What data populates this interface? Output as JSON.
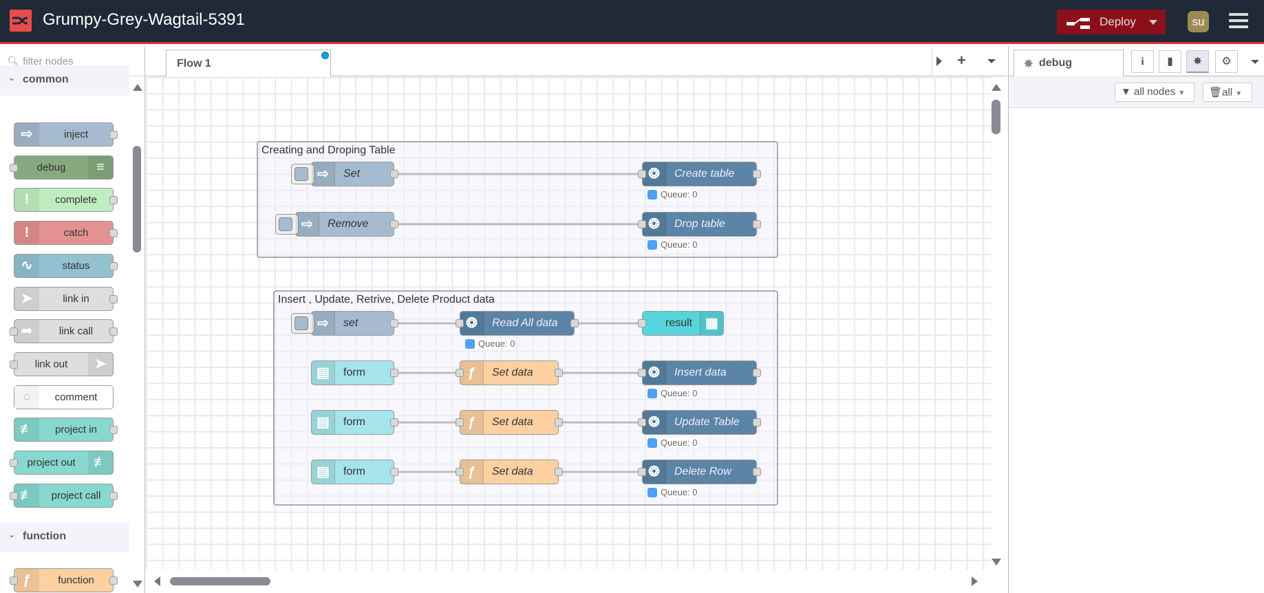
{
  "header": {
    "title": "Grumpy-Grey-Wagtail-5391",
    "deploy_label": "Deploy",
    "avatar_initials": "su",
    "accent": "#8c101c"
  },
  "palette": {
    "filter_placeholder": "filter nodes",
    "categories": [
      {
        "label": "common",
        "nodes": [
          {
            "label": "inject",
            "color": "#a6bbcf",
            "icon": "arrow-right-icon",
            "icon_side": "left",
            "in": false,
            "out": true
          },
          {
            "label": "debug",
            "color": "#87a980",
            "icon": "list-icon",
            "icon_side": "right",
            "in": true,
            "out": false
          },
          {
            "label": "complete",
            "color": "#c0edc0",
            "icon": "exclamation-icon",
            "icon_side": "left",
            "in": false,
            "out": true
          },
          {
            "label": "catch",
            "color": "#e49191",
            "icon": "exclamation-icon",
            "icon_side": "left",
            "in": false,
            "out": true
          },
          {
            "label": "status",
            "color": "#94c1d0",
            "icon": "pulse-icon",
            "icon_side": "left",
            "in": false,
            "out": true
          },
          {
            "label": "link in",
            "color": "#dddddd",
            "icon": "link-in-icon",
            "icon_side": "left",
            "in": false,
            "out": true
          },
          {
            "label": "link call",
            "color": "#dddddd",
            "icon": "link-call-icon",
            "icon_side": "left",
            "in": true,
            "out": true
          },
          {
            "label": "link out",
            "color": "#dddddd",
            "icon": "link-out-icon",
            "icon_side": "right",
            "in": true,
            "out": false
          },
          {
            "label": "comment",
            "color": "#ffffff",
            "icon": "speech-bubble-icon",
            "icon_side": "left",
            "in": false,
            "out": false
          },
          {
            "label": "project in",
            "color": "#87d8cf",
            "icon": "project-link-icon",
            "icon_side": "left",
            "in": false,
            "out": true
          },
          {
            "label": "project out",
            "color": "#87d8cf",
            "icon": "project-link-icon",
            "icon_side": "right",
            "in": true,
            "out": false
          },
          {
            "label": "project call",
            "color": "#87d8cf",
            "icon": "project-link-icon",
            "icon_side": "left",
            "in": true,
            "out": true
          }
        ]
      },
      {
        "label": "function",
        "nodes": [
          {
            "label": "function",
            "color": "#fdd0a2",
            "icon": "function-icon",
            "icon_side": "left",
            "in": true,
            "out": true
          }
        ]
      }
    ]
  },
  "workspace": {
    "tabs": [
      {
        "label": "Flow 1",
        "modified": true
      }
    ],
    "groups": [
      {
        "label": "Creating and Droping Table"
      },
      {
        "label": "Insert , Update, Retrive, Delete Product data"
      }
    ],
    "nodes": [
      {
        "id": "n1",
        "label": "Set",
        "type": "inject",
        "color": "#a6bbcf",
        "icon": "arrow-right-icon"
      },
      {
        "id": "n2",
        "label": "Create table",
        "type": "postgresql",
        "color": "#5b84a6",
        "icon": "postgres-elephant-icon",
        "status": "Queue: 0"
      },
      {
        "id": "n3",
        "label": "Remove",
        "type": "inject",
        "color": "#a6bbcf",
        "icon": "arrow-right-icon"
      },
      {
        "id": "n4",
        "label": "Drop table",
        "type": "postgresql",
        "color": "#5b84a6",
        "icon": "postgres-elephant-icon",
        "status": "Queue: 0"
      },
      {
        "id": "n5",
        "label": "set",
        "type": "inject",
        "color": "#a6bbcf",
        "icon": "arrow-right-icon"
      },
      {
        "id": "n6",
        "label": "Read All data",
        "type": "postgresql",
        "color": "#5b84a6",
        "icon": "postgres-elephant-icon",
        "status": "Queue: 0"
      },
      {
        "id": "n7",
        "label": "result",
        "type": "ui-table",
        "color": "#56d4db",
        "icon": "table-icon"
      },
      {
        "id": "n8",
        "label": "form",
        "type": "ui-form",
        "color": "#a5e4ea",
        "icon": "form-icon"
      },
      {
        "id": "n9",
        "label": "Set data",
        "type": "function",
        "color": "#fdd0a2",
        "icon": "function-icon"
      },
      {
        "id": "n10",
        "label": "Insert data",
        "type": "postgresql",
        "color": "#5b84a6",
        "icon": "postgres-elephant-icon",
        "status": "Queue: 0"
      },
      {
        "id": "n11",
        "label": "form",
        "type": "ui-form",
        "color": "#a5e4ea",
        "icon": "form-icon"
      },
      {
        "id": "n12",
        "label": "Set data",
        "type": "function",
        "color": "#fdd0a2",
        "icon": "function-icon"
      },
      {
        "id": "n13",
        "label": "Update Table",
        "type": "postgresql",
        "color": "#5b84a6",
        "icon": "postgres-elephant-icon",
        "status": "Queue: 0"
      },
      {
        "id": "n14",
        "label": "form",
        "type": "ui-form",
        "color": "#a5e4ea",
        "icon": "form-icon"
      },
      {
        "id": "n15",
        "label": "Set data",
        "type": "function",
        "color": "#fdd0a2",
        "icon": "function-icon"
      },
      {
        "id": "n16",
        "label": "Delete Row",
        "type": "postgresql",
        "color": "#5b84a6",
        "icon": "postgres-elephant-icon",
        "status": "Queue: 0"
      }
    ],
    "wires": [
      [
        "n1",
        "n2"
      ],
      [
        "n3",
        "n4"
      ],
      [
        "n5",
        "n6"
      ],
      [
        "n6",
        "n7"
      ],
      [
        "n8",
        "n9"
      ],
      [
        "n9",
        "n10"
      ],
      [
        "n11",
        "n12"
      ],
      [
        "n12",
        "n13"
      ],
      [
        "n14",
        "n15"
      ],
      [
        "n15",
        "n16"
      ]
    ]
  },
  "sidebar": {
    "tab_label": "debug",
    "buttons": [
      "info-icon",
      "book-icon",
      "bug-icon",
      "gear-icon"
    ],
    "filter_label": "all nodes",
    "clear_label": "all"
  }
}
